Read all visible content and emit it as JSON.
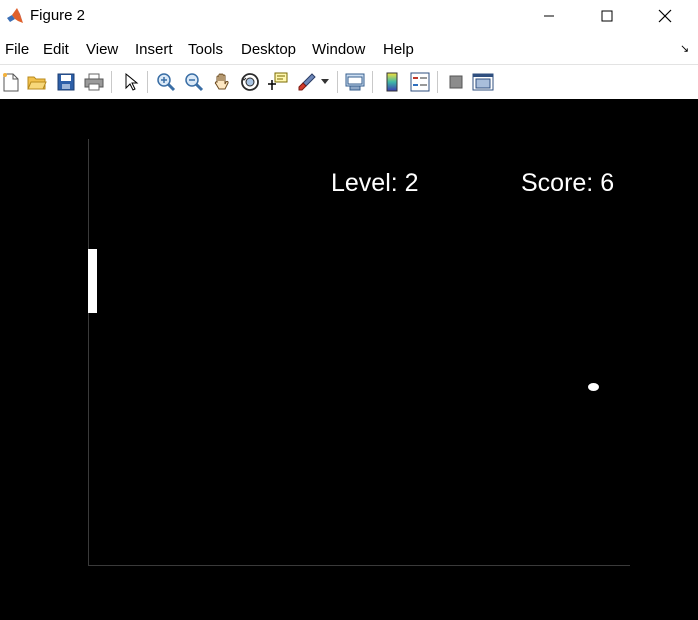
{
  "window": {
    "title": "Figure 2"
  },
  "menubar": {
    "items": [
      {
        "label": "File"
      },
      {
        "label": "Edit"
      },
      {
        "label": "View"
      },
      {
        "label": "Insert"
      },
      {
        "label": "Tools"
      },
      {
        "label": "Desktop"
      },
      {
        "label": "Window"
      },
      {
        "label": "Help"
      }
    ]
  },
  "toolbar": {
    "buttons": [
      {
        "icon": "new-figure-icon"
      },
      {
        "icon": "open-file-icon"
      },
      {
        "icon": "save-icon"
      },
      {
        "icon": "print-icon"
      },
      {
        "icon": "edit-plot-arrow-icon"
      },
      {
        "icon": "zoom-in-icon"
      },
      {
        "icon": "zoom-out-icon"
      },
      {
        "icon": "pan-hand-icon"
      },
      {
        "icon": "rotate-3d-icon"
      },
      {
        "icon": "data-cursor-icon"
      },
      {
        "icon": "brush-icon"
      },
      {
        "icon": "link-plot-icon"
      },
      {
        "icon": "insert-colorbar-icon"
      },
      {
        "icon": "insert-legend-icon"
      },
      {
        "icon": "hide-plot-tools-icon"
      },
      {
        "icon": "show-plot-tools-icon"
      }
    ]
  },
  "game": {
    "level_text": "Level: 2",
    "score_text": "Score: 6",
    "level": 2,
    "score": 6
  },
  "colors": {
    "background": "#000000",
    "foreground": "#ffffff",
    "axes": "#3a3a3a"
  }
}
